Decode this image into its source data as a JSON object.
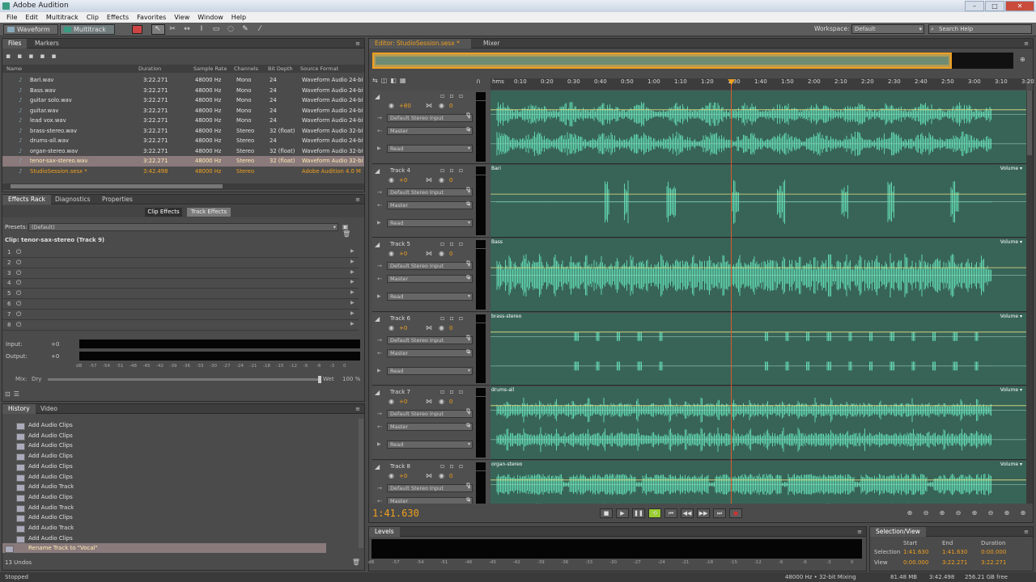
{
  "app": {
    "title": "Adobe Audition"
  },
  "menu": [
    "File",
    "Edit",
    "Multitrack",
    "Clip",
    "Effects",
    "Favorites",
    "View",
    "Window",
    "Help"
  ],
  "toolbar": {
    "waveform_label": "Waveform",
    "multitrack_label": "Multitrack",
    "workspace_label": "Workspace:",
    "workspace_value": "Default",
    "search_placeholder": "Search Help"
  },
  "files_panel": {
    "tabs": [
      "Files",
      "Markers"
    ],
    "columns": [
      "Name",
      "Duration",
      "Sample Rate",
      "Channels",
      "Bit Depth",
      "Source Format"
    ],
    "rows": [
      {
        "name": "Bari.wav",
        "duration": "3:22.271",
        "rate": "48000 Hz",
        "channels": "Mono",
        "depth": "24",
        "format": "Waveform Audio 24-bit"
      },
      {
        "name": "Bass.wav",
        "duration": "3:22.271",
        "rate": "48000 Hz",
        "channels": "Mono",
        "depth": "24",
        "format": "Waveform Audio 24-bit"
      },
      {
        "name": "guitar solo.wav",
        "duration": "3:22.271",
        "rate": "48000 Hz",
        "channels": "Mono",
        "depth": "24",
        "format": "Waveform Audio 24-bit"
      },
      {
        "name": "guitar.wav",
        "duration": "3:22.271",
        "rate": "48000 Hz",
        "channels": "Mono",
        "depth": "24",
        "format": "Waveform Audio 24-bit"
      },
      {
        "name": "lead vox.wav",
        "duration": "3:22.271",
        "rate": "48000 Hz",
        "channels": "Mono",
        "depth": "24",
        "format": "Waveform Audio 24-bit"
      },
      {
        "name": "brass-stereo.wav",
        "duration": "3:22.271",
        "rate": "48000 Hz",
        "channels": "Stereo",
        "depth": "32 (float)",
        "format": "Waveform Audio 32-bit"
      },
      {
        "name": "drums-all.wav",
        "duration": "3:22.271",
        "rate": "48000 Hz",
        "channels": "Stereo",
        "depth": "24",
        "format": "Waveform Audio 24-bit"
      },
      {
        "name": "organ-stereo.wav",
        "duration": "3:22.271",
        "rate": "48000 Hz",
        "channels": "Stereo",
        "depth": "32 (float)",
        "format": "Waveform Audio 32-bit"
      },
      {
        "name": "tenor-sax-stereo.wav",
        "duration": "3:22.271",
        "rate": "48000 Hz",
        "channels": "Stereo",
        "depth": "32 (float)",
        "format": "Waveform Audio 32-bit"
      },
      {
        "name": "StudioSession.sesx *",
        "duration": "3:42.498",
        "rate": "48000 Hz",
        "channels": "Stereo",
        "depth": "",
        "format": "Adobe Audition 4.0 M"
      }
    ]
  },
  "effects_panel": {
    "tabs": [
      "Effects Rack",
      "Diagnostics",
      "Properties"
    ],
    "clip_effects": "Clip Effects",
    "track_effects": "Track Effects",
    "presets_label": "Presets:",
    "presets_value": "(Default)",
    "clip_label": "Clip: tenor-sax-stereo (Track 9)",
    "slots": [
      "1",
      "2",
      "3",
      "4",
      "5",
      "6",
      "7",
      "8"
    ],
    "input_label": "Input:",
    "output_label": "Output:",
    "gain_value": "+0",
    "meter_scale": [
      "dB",
      "-57",
      "-54",
      "-51",
      "-48",
      "-45",
      "-42",
      "-39",
      "-36",
      "-33",
      "-30",
      "-27",
      "-24",
      "-21",
      "-18",
      "-15",
      "-12",
      "-9",
      "-6",
      "-3",
      "0"
    ],
    "mix_label": "Mix:",
    "dry_label": "Dry",
    "wet_label": "Wet",
    "mix_value": "100 %"
  },
  "history_panel": {
    "tabs": [
      "History",
      "Video"
    ],
    "items": [
      "Add Audio Clips",
      "Add Audio Clips",
      "Add Audio Clips",
      "Add Audio Clips",
      "Add Audio Clips",
      "Add Audio Clips",
      "Add Audio Track",
      "Add Audio Clips",
      "Add Audio Track",
      "Add Audio Clips",
      "Add Audio Track",
      "Add Audio Clips",
      "Rename Track to \"Vocal\""
    ],
    "undos": "13 Undos"
  },
  "editor": {
    "tabs": [
      "Editor: StudioSession.sesx *",
      "Mixer"
    ],
    "ruler": [
      "hms",
      "0:10",
      "0:20",
      "0:30",
      "0:40",
      "0:50",
      "1:00",
      "1:10",
      "1:20",
      "1:30",
      "1:40",
      "1:50",
      "2:00",
      "2:10",
      "2:20",
      "2:30",
      "2:40",
      "2:50",
      "3:00",
      "3:10",
      "3:20"
    ],
    "playhead_fraction": 0.449,
    "time_display": "1:41.630",
    "volume_label": "Volume",
    "input_value": "Default Stereo Input",
    "output_value": "Master",
    "mode_value": "Read",
    "gain_value": "+0",
    "tracks": [
      {
        "name": "",
        "clip": "",
        "gain_value": "+80"
      },
      {
        "name": "Track 4",
        "clip": "Bari"
      },
      {
        "name": "Track 5",
        "clip": "Bass"
      },
      {
        "name": "Track 6",
        "clip": "brass-stereo"
      },
      {
        "name": "Track 7",
        "clip": "drums-all"
      },
      {
        "name": "Track 8",
        "clip": "organ-stereo"
      }
    ]
  },
  "levels_panel": {
    "title": "Levels",
    "scale": [
      "dB",
      "-57",
      "-54",
      "-51",
      "-48",
      "-45",
      "-42",
      "-39",
      "-36",
      "-33",
      "-30",
      "-27",
      "-24",
      "-21",
      "-18",
      "-15",
      "-12",
      "-9",
      "-6",
      "-3",
      "0"
    ]
  },
  "selection_panel": {
    "title": "Selection/View",
    "headers": [
      "Start",
      "End",
      "Duration"
    ],
    "selection_label": "Selection",
    "view_label": "View",
    "selection": [
      "1:41.630",
      "1:41.630",
      "0:00.000"
    ],
    "view": [
      "0:00.000",
      "3:22.271",
      "3:22.271"
    ]
  },
  "status": {
    "left": "Stopped",
    "format": "48000 Hz • 32-bit Mixing",
    "size": "81.48 MB",
    "duration": "3:42.498",
    "free": "256.21 GB free"
  },
  "colors": {
    "wave": "#5fd4ad",
    "lane": "#386457",
    "playhead": "#e05a2a",
    "orange": "#f0a020",
    "selected_row": "#8a7a7c"
  }
}
